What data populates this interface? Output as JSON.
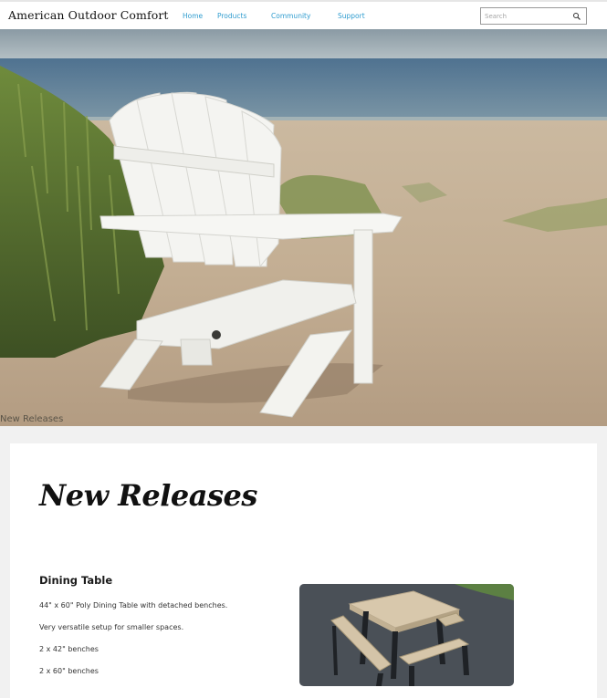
{
  "header": {
    "brand": "American Outdoor Comfort",
    "nav": [
      {
        "label": "Home"
      },
      {
        "label": "Products"
      },
      {
        "label": "Community"
      },
      {
        "label": "Support"
      }
    ],
    "search": {
      "placeholder": "Search",
      "icon": "search-icon"
    }
  },
  "hero": {
    "caption": "New Releases"
  },
  "main": {
    "title": "New Releases",
    "product": {
      "name": "Dining Table",
      "details": [
        "44\" x 60\" Poly Dining Table with detached benches.",
        "Very versatile setup for smaller spaces.",
        "2 x 42\" benches",
        "2 x 60\" benches"
      ]
    }
  },
  "colors": {
    "nav_link": "#2f9ccf",
    "page_bg": "#f1f1f1",
    "card_bg": "#ffffff"
  }
}
